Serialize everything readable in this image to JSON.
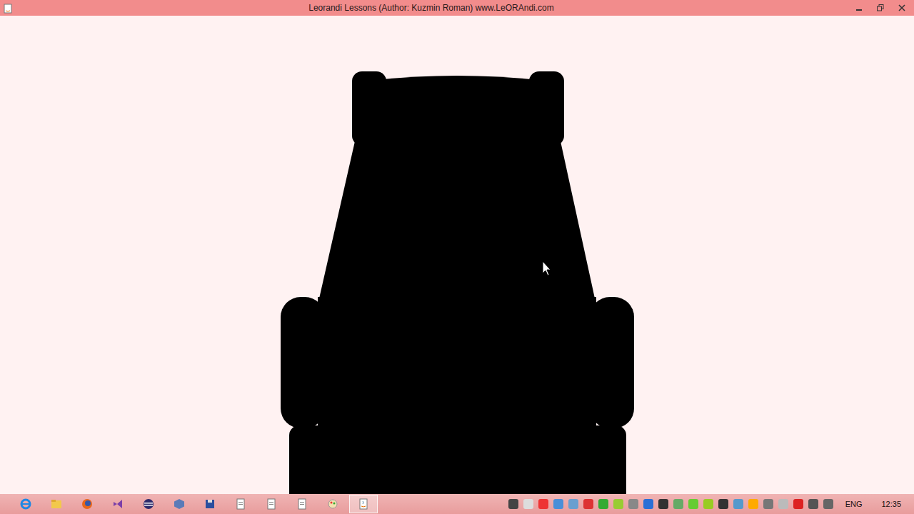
{
  "window": {
    "title": "Leorandi Lessons (Author: Kuzmin Roman) www.LeORAndi.com"
  },
  "taskbar": {
    "apps": [
      {
        "kind": "ie",
        "selected": false
      },
      {
        "kind": "folder",
        "selected": false
      },
      {
        "kind": "firefox",
        "selected": false
      },
      {
        "kind": "vs",
        "selected": false
      },
      {
        "kind": "eclipse",
        "selected": false
      },
      {
        "kind": "box",
        "selected": false
      },
      {
        "kind": "save",
        "selected": false
      },
      {
        "kind": "doc",
        "selected": false
      },
      {
        "kind": "doc",
        "selected": false
      },
      {
        "kind": "doc",
        "selected": false
      },
      {
        "kind": "paint",
        "selected": false
      },
      {
        "kind": "java",
        "selected": true
      }
    ],
    "language": "ENG",
    "clock": "12:35"
  }
}
